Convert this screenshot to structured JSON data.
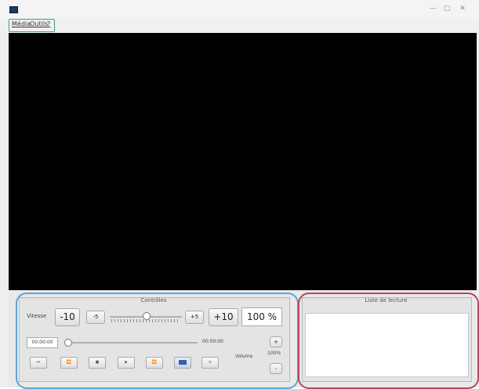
{
  "window": {
    "minimize": "—",
    "maximize": "▢",
    "close": "✕"
  },
  "menubar": {
    "items": [
      "Média",
      "Outils",
      "?"
    ]
  },
  "controls": {
    "title": "Contrôles",
    "speed_label": "Vitesse",
    "btn_minus10": "-10",
    "btn_minus5": "-5",
    "btn_plus5": "+5",
    "btn_plus10": "+10",
    "speed_value": "100 %",
    "speed_slider_value": 0.5,
    "position_start": "00:00:00",
    "position_end": "00:00:00",
    "position_slider_value": 0.0,
    "volume_label": "Volume",
    "volume_value": "100%",
    "volume_up": "+",
    "volume_down": "-",
    "transport_buttons": [
      "previous-icon",
      "rewind-icon",
      "stop-icon",
      "play-icon",
      "forward-icon",
      "fullscreen-icon",
      "playlist-toggle-icon"
    ]
  },
  "playlist": {
    "title": "Liste de lecture"
  },
  "accent": {
    "menu_highlight": "#39a566",
    "controls_highlight": "#5aa7d8",
    "playlist_highlight": "#b5475c"
  }
}
